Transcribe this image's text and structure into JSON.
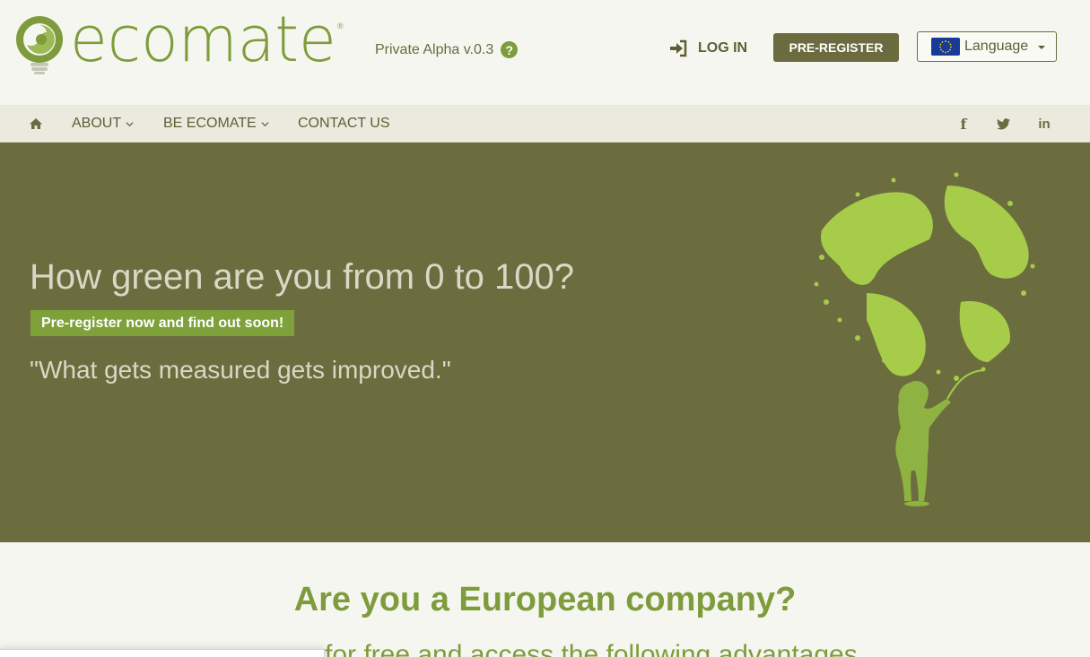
{
  "header": {
    "logo_text": "ecomate",
    "logo_reg": "®",
    "version": "Private Alpha v.0.3",
    "help_icon": "question-circle-icon",
    "login_label": "LOG IN",
    "login_icon": "sign-in-icon",
    "preregister_label": "PRE-REGISTER",
    "language_label": "Language",
    "language_flag": "eu-flag-icon"
  },
  "nav": {
    "home_icon": "home-icon",
    "items": [
      {
        "label": "ABOUT",
        "dropdown": true
      },
      {
        "label": "BE ECOMATE",
        "dropdown": true
      },
      {
        "label": "CONTACT US",
        "dropdown": false
      }
    ],
    "social": [
      {
        "label": "f",
        "icon": "facebook-icon"
      },
      {
        "label": "twitter",
        "icon": "twitter-icon"
      },
      {
        "label": "in",
        "icon": "linkedin-icon"
      }
    ]
  },
  "hero": {
    "title": "How green are you from 0 to 100?",
    "cta_label": "Pre-register now and find out soon!",
    "quote": "\"What gets measured gets improved.\""
  },
  "section": {
    "title": "Are you a European company?",
    "subtitle": "for free and access the following advantages"
  },
  "colors": {
    "brand_green": "#7e9c3c",
    "olive": "#6b6d3e",
    "background": "#f6f6f0"
  }
}
